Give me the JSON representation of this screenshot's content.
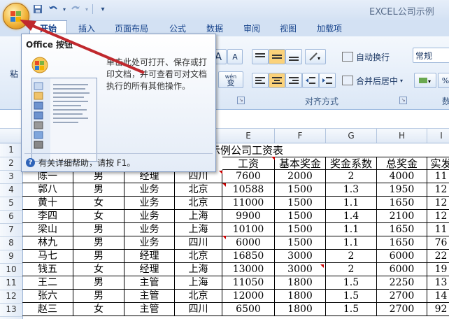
{
  "window": {
    "title": "EXCEL公司示例"
  },
  "quick_access": {
    "icons": [
      "save-icon",
      "undo-icon",
      "redo-icon",
      "customize-icon"
    ]
  },
  "tabs": [
    {
      "label": "开始",
      "active": true
    },
    {
      "label": "插入"
    },
    {
      "label": "页面布局"
    },
    {
      "label": "公式"
    },
    {
      "label": "数据"
    },
    {
      "label": "审阅"
    },
    {
      "label": "视图"
    },
    {
      "label": "加载项"
    }
  ],
  "ribbon": {
    "paste_label": "粘",
    "wrap_text": "自动换行",
    "merge_center": "合并后居中",
    "number_format": "常规",
    "alignment_group": "对齐方式",
    "number_group_partial": "数",
    "font_size_large": "A",
    "font_size_small": "A",
    "phonetic": "wén",
    "phonetic_char": "变",
    "percent": "%"
  },
  "tooltip": {
    "title": "Office 按钮",
    "text": "单击此处可打开、保存或打印文档，并可查看可对文档执行的所有其他操作。",
    "help": "有关详细帮助，请按 F1。"
  },
  "sheet": {
    "columns": [
      "E",
      "F",
      "G",
      "H",
      "I"
    ],
    "row_numbers": [
      "1",
      "2",
      "3",
      "4",
      "5",
      "6",
      "7",
      "8",
      "9",
      "10",
      "11",
      "12",
      "13"
    ],
    "title": "示例公司工资表",
    "headers": [
      "工资",
      "基本奖金",
      "奖金系数",
      "总奖金",
      "实发"
    ],
    "rows": [
      [
        "陈一",
        "男",
        "经理",
        "四川",
        "7600",
        "2000",
        "2",
        "4000",
        "11"
      ],
      [
        "郭八",
        "男",
        "业务",
        "北京",
        "10588",
        "1500",
        "1.3",
        "1950",
        "12"
      ],
      [
        "黄十",
        "女",
        "业务",
        "北京",
        "11000",
        "1500",
        "1.1",
        "1650",
        "12"
      ],
      [
        "李四",
        "女",
        "业务",
        "上海",
        "9900",
        "1500",
        "1.4",
        "2100",
        "12"
      ],
      [
        "梁山",
        "男",
        "业务",
        "上海",
        "10100",
        "1500",
        "1.1",
        "1650",
        "11"
      ],
      [
        "林九",
        "男",
        "业务",
        "四川",
        "6000",
        "1500",
        "1.1",
        "1650",
        "76"
      ],
      [
        "马七",
        "男",
        "经理",
        "北京",
        "16850",
        "3000",
        "2",
        "6000",
        "22"
      ],
      [
        "钱五",
        "女",
        "经理",
        "上海",
        "13000",
        "3000",
        "2",
        "6000",
        "19"
      ],
      [
        "王二",
        "男",
        "主管",
        "上海",
        "11050",
        "1800",
        "1.5",
        "2250",
        "13"
      ],
      [
        "张六",
        "男",
        "主管",
        "北京",
        "12000",
        "1800",
        "1.5",
        "2700",
        "14"
      ],
      [
        "赵三",
        "女",
        "主管",
        "四川",
        "6500",
        "1800",
        "1.5",
        "2700",
        "92"
      ]
    ]
  }
}
